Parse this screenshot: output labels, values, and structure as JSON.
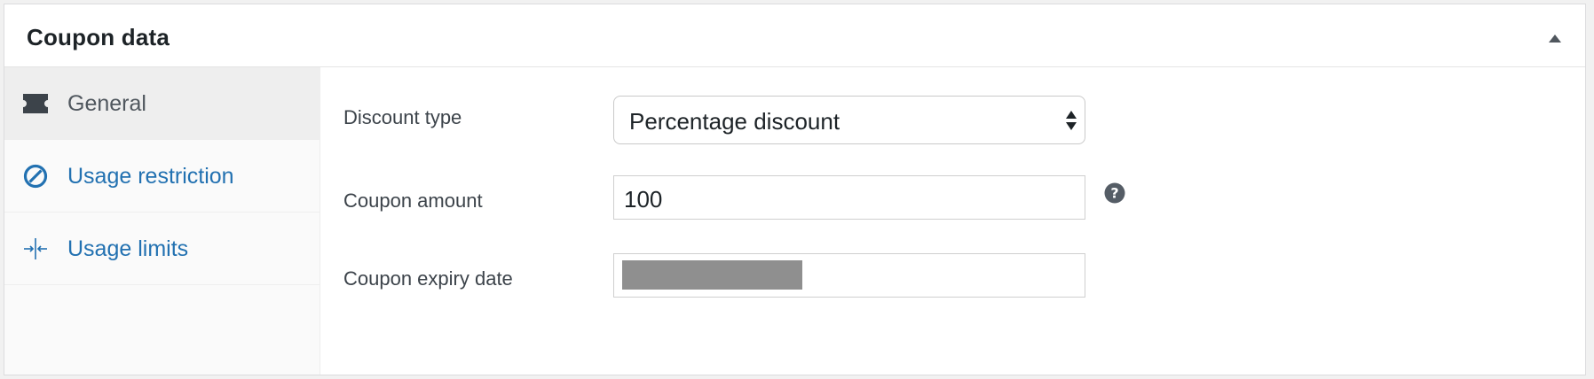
{
  "panel": {
    "title": "Coupon data"
  },
  "tabs": [
    {
      "label": "General",
      "icon": "ticket-icon",
      "active": true
    },
    {
      "label": "Usage restriction",
      "icon": "block-icon",
      "active": false
    },
    {
      "label": "Usage limits",
      "icon": "limits-icon",
      "active": false
    }
  ],
  "fields": {
    "discount_type": {
      "label": "Discount type",
      "value": "Percentage discount"
    },
    "coupon_amount": {
      "label": "Coupon amount",
      "value": "100"
    },
    "expiry_date": {
      "label": "Coupon expiry date"
    }
  },
  "colors": {
    "link": "#2271b1",
    "active_tab_text": "#50575e",
    "icon_dark": "#3c434a",
    "redaction": "#8f8f8f"
  }
}
